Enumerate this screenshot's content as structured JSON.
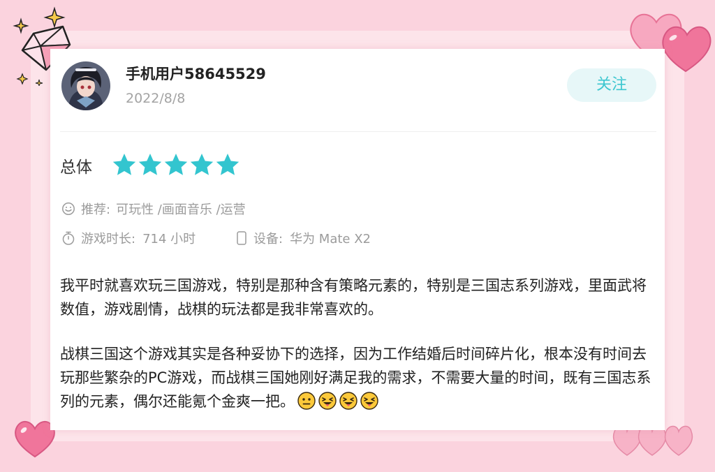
{
  "user": {
    "name": "手机用户58645529",
    "date": "2022/8/8",
    "follow_label": "关注"
  },
  "rating": {
    "label": "总体",
    "stars": 5,
    "max_stars": 5,
    "star_color": "#33c5cf"
  },
  "meta": {
    "recommend_label": "推荐:",
    "recommend_tags": "可玩性 /画面音乐 /运营",
    "playtime_label": "游戏时长:",
    "playtime_value": "714 小时",
    "device_label": "设备:",
    "device_value": "华为 Mate X2"
  },
  "review": {
    "paragraph_1": "我平时就喜欢玩三国游戏，特别是那种含有策略元素的，特别是三国志系列游戏，里面武将数值，游戏剧情，战棋的玩法都是我非常喜欢的。",
    "paragraph_2": "战棋三国这个游戏其实是各种妥协下的选择，因为工作结婚后时间碎片化，根本没有时间去玩那些繁杂的PC游戏，而战棋三国她刚好满足我的需求，不需要大量的时间，既有三国志系列的元素，偶尔还能氪个金爽一把。",
    "emojis": [
      "neutral-face",
      "tongue-face",
      "tongue-face",
      "tongue-face"
    ]
  },
  "colors": {
    "accent": "#33c5cf",
    "background": "#fbd3de",
    "heart": "#f0759b"
  }
}
